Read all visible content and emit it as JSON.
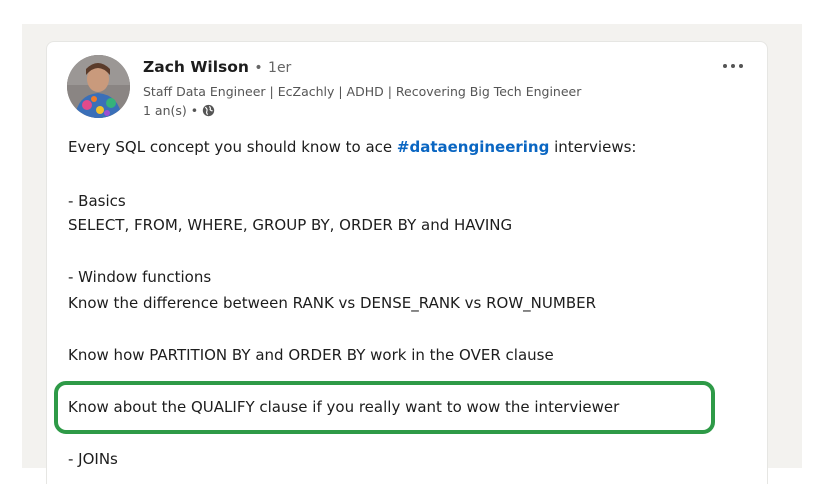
{
  "post": {
    "author_name": "Zach Wilson",
    "separator": "•",
    "degree": "1er",
    "headline": "Staff Data Engineer | EcZachly | ADHD | Recovering Big Tech Engineer",
    "time": "1 an(s) •",
    "visibility_icon": "globe-icon",
    "more_icon": "more-options-icon",
    "intro_before": "Every SQL concept you should know to ace ",
    "hashtag": "#dataengineering",
    "intro_after": " interviews:",
    "lines": [
      "- Basics",
      "SELECT, FROM, WHERE, GROUP BY, ORDER BY and HAVING",
      "- Window functions",
      "Know the difference between RANK vs DENSE_RANK vs ROW_NUMBER",
      "Know how PARTITION BY and ORDER BY work in the OVER clause",
      "Know about the QUALIFY clause if you really want to wow the interviewer",
      "- JOINs"
    ]
  },
  "colors": {
    "hashtag": "#0a66c2",
    "highlight_border": "#2e9a47",
    "page_background": "#f3f2ef"
  }
}
